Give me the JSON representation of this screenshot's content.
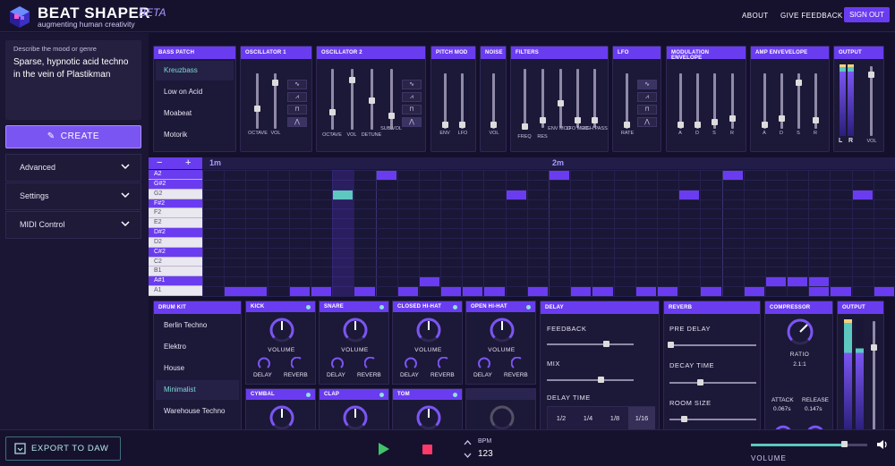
{
  "header": {
    "brand": "BEAT SHAPER",
    "beta": "BETA",
    "tagline": "augmenting human creativity",
    "nav": {
      "about": "ABOUT",
      "feedback": "GIVE FEEDBACK",
      "signout": "SIGN OUT"
    }
  },
  "left": {
    "prompt_label": "Describe the mood or genre",
    "prompt_value": "Sparse, hypnotic acid techno in the vein of Plastikman",
    "create_label": "CREATE",
    "accordions": [
      "Advanced",
      "Settings",
      "MIDI Control"
    ]
  },
  "bass_patch": {
    "title": "BASS PATCH",
    "items": [
      "Kreuzbass",
      "Low on Acid",
      "Moabeat",
      "Motorik"
    ],
    "selected": "Kreuzbass"
  },
  "synth": {
    "osc1": {
      "title": "OSCILLATOR 1",
      "labels": [
        "OCTAVE",
        "VOL"
      ]
    },
    "osc2": {
      "title": "OSCILLATOR 2",
      "labels": [
        "OCTAVE",
        "VOL",
        "DETUNE",
        "SUB VOL"
      ]
    },
    "pitch": {
      "title": "PITCH MOD",
      "labels": [
        "ENV",
        "LFO"
      ]
    },
    "noise": {
      "title": "NOISE",
      "labels": [
        "VOL"
      ]
    },
    "filters": {
      "title": "FILTERS",
      "labels": [
        "FREQ",
        "RES",
        "ENV MOD",
        "LFO MOD",
        "HIGH PASS"
      ]
    },
    "lfo": {
      "title": "LFO",
      "labels": [
        "RATE"
      ]
    },
    "modenv": {
      "title": "MODULATION ENVELOPE",
      "labels": [
        "A",
        "D",
        "S",
        "R"
      ]
    },
    "ampenv": {
      "title": "AMP ENVEVELOPE",
      "labels": [
        "A",
        "D",
        "S",
        "R"
      ]
    },
    "output": {
      "title": "OUTPUT",
      "labels": [
        "L",
        "R",
        "VOL"
      ]
    }
  },
  "roll": {
    "minus": "−",
    "plus": "+",
    "markers": [
      "1m",
      "2m"
    ],
    "keys": [
      "A2",
      "G#2",
      "G2",
      "F#2",
      "F2",
      "E2",
      "D#2",
      "D2",
      "C#2",
      "C2",
      "B1",
      "A#1",
      "A1"
    ]
  },
  "drum_kit": {
    "title": "DRUM KIT",
    "items": [
      "Berlin Techno",
      "Elektro",
      "House",
      "Minimalist",
      "Warehouse Techno"
    ],
    "selected": "Minimalist"
  },
  "drums": {
    "kick": "KICK",
    "snare": "SNARE",
    "chh": "CLOSED HI-HAT",
    "ohh": "OPEN HI-HAT",
    "cymbal": "CYMBAL",
    "clap": "CLAP",
    "tom": "TOM",
    "volume": "VOLUME",
    "delay": "DELAY",
    "reverb": "REVERB"
  },
  "delay": {
    "title": "DELAY",
    "feedback": "FEEDBACK",
    "mix": "MIX",
    "time": "DELAY TIME",
    "options": [
      "1/2",
      "1/4",
      "1/8",
      "1/16"
    ],
    "selected": "1/16",
    "feedback_value": 0.68,
    "mix_value": 0.62
  },
  "reverb": {
    "title": "REVERB",
    "pre": "PRE DELAY",
    "decay": "DECAY TIME",
    "room": "ROOM SIZE"
  },
  "compressor": {
    "title": "COMPRESSOR",
    "ratio": "RATIO",
    "ratio_val": "2.1:1",
    "attack": "ATTACK",
    "attack_val": "0.067s",
    "release": "RELEASE",
    "release_val": "0.147s"
  },
  "drum_output": {
    "title": "OUTPUT"
  },
  "bottom": {
    "export": "EXPORT TO DAW",
    "bpm_label": "BPM",
    "bpm": "123",
    "volume": "VOLUME"
  },
  "colors": {
    "accent": "#6a3cf0",
    "teal": "#5cc8c0",
    "note": "#6a3cf0",
    "bg": "#14102c"
  }
}
